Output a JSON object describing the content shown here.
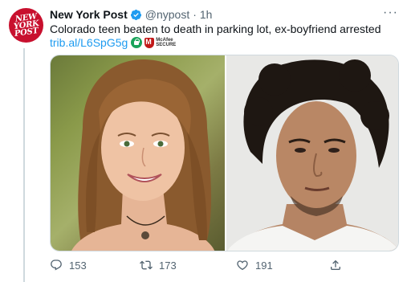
{
  "tweet": {
    "avatar_text": [
      "NEW",
      "YORK",
      "POST"
    ],
    "name": "New York Post",
    "handle": "@nypost",
    "separator": "·",
    "time": "1h",
    "more": "···",
    "text": "Colorado teen beaten to death in parking lot, ex-boyfriend arrested",
    "link": "trib.al/L6SpG5g",
    "mcafee_line1": "McAfee",
    "mcafee_line2": "SECURE"
  },
  "actions": {
    "replies": "153",
    "retweets": "173",
    "likes": "191"
  },
  "colors": {
    "brand_red": "#c8102e",
    "link_blue": "#1d9bf0",
    "muted": "#536471",
    "verified": "#1d9bf0"
  },
  "icons": [
    "verified-badge-icon",
    "more-icon",
    "lock-icon",
    "mcafee-shield-icon",
    "reply-icon",
    "retweet-icon",
    "like-icon",
    "share-icon"
  ]
}
